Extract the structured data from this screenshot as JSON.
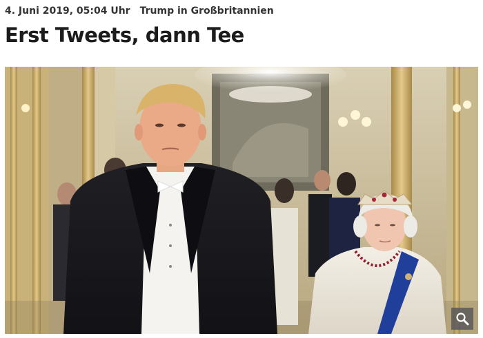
{
  "article": {
    "dateline": "4. Juni 2019, 05:04 Uhr",
    "kicker": "Trump in Großbritannien",
    "headline": "Erst Tweets, dann Tee"
  },
  "image": {
    "zoom_icon": "magnifier-icon"
  },
  "colors": {
    "zoom_button_bg": "#5a5a5a",
    "headline_text": "#1c1c1c"
  }
}
